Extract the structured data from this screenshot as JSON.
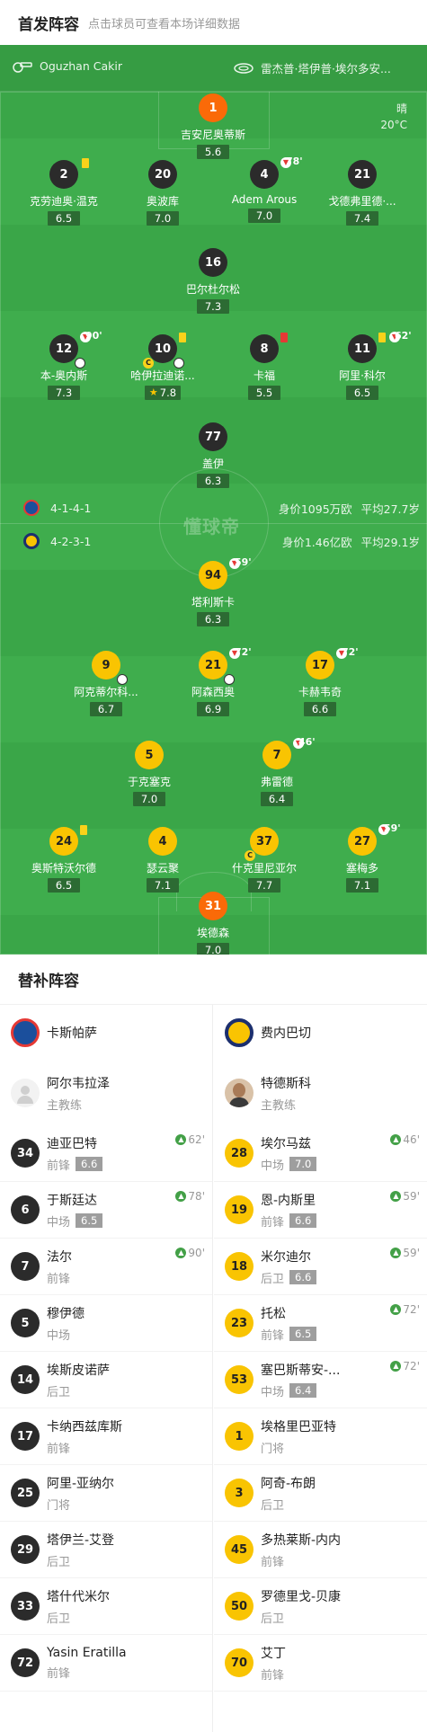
{
  "header": {
    "title": "首发阵容",
    "subtitle": "点击球员可查看本场详细数据"
  },
  "pitch": {
    "referee": "Oguzhan Cakir",
    "venue": "雷杰普·塔伊普·埃尔多安...",
    "weather": "晴",
    "temperature": "20°C",
    "watermark": "懂球帝",
    "home_formation": "4-1-4-1",
    "away_formation": "4-2-3-1",
    "home_value": "身价1095万欧",
    "home_avg_age": "平均27.7岁",
    "away_value": "身价1.46亿欧",
    "away_avg_age": "平均29.1岁",
    "colors": {
      "pitch": "#3aa648",
      "home": "#2b2b2b",
      "away": "#f9c402",
      "gk": "#fa6a08"
    },
    "home_players": [
      {
        "number": "1",
        "name": "吉安尼奥蒂斯",
        "rating": "5.6"
      },
      {
        "number": "2",
        "name": "克劳迪奥·温克",
        "rating": "6.5"
      },
      {
        "number": "20",
        "name": "奥波库",
        "rating": "7.0"
      },
      {
        "number": "4",
        "name": "Adem Arous",
        "rating": "7.0",
        "sub_time": "78'"
      },
      {
        "number": "21",
        "name": "戈德弗里德·...",
        "rating": "7.4"
      },
      {
        "number": "16",
        "name": "巴尔杜尔松",
        "rating": "7.3"
      },
      {
        "number": "12",
        "name": "本-奥内斯",
        "rating": "7.3",
        "sub_time": "90'"
      },
      {
        "number": "10",
        "name": "哈伊拉迪诺...",
        "rating": "7.8"
      },
      {
        "number": "8",
        "name": "卡福",
        "rating": "5.5"
      },
      {
        "number": "11",
        "name": "阿里·科尔",
        "rating": "6.5",
        "sub_time": "62'"
      },
      {
        "number": "77",
        "name": "盖伊",
        "rating": "6.3"
      }
    ],
    "away_players": [
      {
        "number": "94",
        "name": "塔利斯卡",
        "rating": "6.3",
        "sub_time": "59'"
      },
      {
        "number": "9",
        "name": "阿克蒂尔科...",
        "rating": "6.7"
      },
      {
        "number": "21",
        "name": "阿森西奥",
        "rating": "6.9",
        "sub_time": "72'"
      },
      {
        "number": "17",
        "name": "卡赫韦奇",
        "rating": "6.6",
        "sub_time": "72'"
      },
      {
        "number": "5",
        "name": "于克塞克",
        "rating": "7.0"
      },
      {
        "number": "7",
        "name": "弗雷德",
        "rating": "6.4",
        "sub_time": "46'"
      },
      {
        "number": "24",
        "name": "奥斯特沃尔德",
        "rating": "6.5"
      },
      {
        "number": "4",
        "name": "瑟云聚",
        "rating": "7.1"
      },
      {
        "number": "37",
        "name": "什克里尼亚尔",
        "rating": "7.7"
      },
      {
        "number": "27",
        "name": "塞梅多",
        "rating": "7.1",
        "sub_time": "59'"
      },
      {
        "number": "31",
        "name": "埃德森",
        "rating": "7.0"
      }
    ]
  },
  "subs": {
    "title": "替补阵容",
    "home": {
      "team": "卡斯帕萨",
      "coach": {
        "name": "阿尔韦拉泽",
        "role": "主教练"
      },
      "players": [
        {
          "number": "34",
          "name": "迪亚巴特",
          "pos": "前锋",
          "rating": "6.6",
          "minute": "62'"
        },
        {
          "number": "6",
          "name": "于斯廷达",
          "pos": "中场",
          "rating": "6.5",
          "minute": "78'"
        },
        {
          "number": "7",
          "name": "法尔",
          "pos": "前锋",
          "minute": "90'"
        },
        {
          "number": "5",
          "name": "穆伊德",
          "pos": "中场"
        },
        {
          "number": "14",
          "name": "埃斯皮诺萨",
          "pos": "后卫"
        },
        {
          "number": "17",
          "name": "卡纳西兹库斯",
          "pos": "前锋"
        },
        {
          "number": "25",
          "name": "阿里-亚纳尔",
          "pos": "门将"
        },
        {
          "number": "29",
          "name": "塔伊兰-艾登",
          "pos": "后卫"
        },
        {
          "number": "33",
          "name": "塔什代米尔",
          "pos": "后卫"
        },
        {
          "number": "72",
          "name": "Yasin Eratilla",
          "pos": "前锋"
        }
      ]
    },
    "away": {
      "team": "费内巴切",
      "coach": {
        "name": "特德斯科",
        "role": "主教练"
      },
      "players": [
        {
          "number": "28",
          "name": "埃尔马兹",
          "pos": "中场",
          "rating": "7.0",
          "minute": "46'"
        },
        {
          "number": "19",
          "name": "恩-内斯里",
          "pos": "前锋",
          "rating": "6.6",
          "minute": "59'"
        },
        {
          "number": "18",
          "name": "米尔迪尔",
          "pos": "后卫",
          "rating": "6.6",
          "minute": "59'"
        },
        {
          "number": "23",
          "name": "托松",
          "pos": "前锋",
          "rating": "6.5",
          "minute": "72'"
        },
        {
          "number": "53",
          "name": "塞巴斯蒂安-...",
          "pos": "中场",
          "rating": "6.4",
          "minute": "72'"
        },
        {
          "number": "1",
          "name": "埃格里巴亚特",
          "pos": "门将"
        },
        {
          "number": "3",
          "name": "阿奇-布朗",
          "pos": "后卫"
        },
        {
          "number": "45",
          "name": "多热莱斯-内内",
          "pos": "前锋"
        },
        {
          "number": "50",
          "name": "罗德里戈-贝康",
          "pos": "后卫"
        },
        {
          "number": "70",
          "name": "艾丁",
          "pos": "前锋"
        }
      ]
    }
  }
}
